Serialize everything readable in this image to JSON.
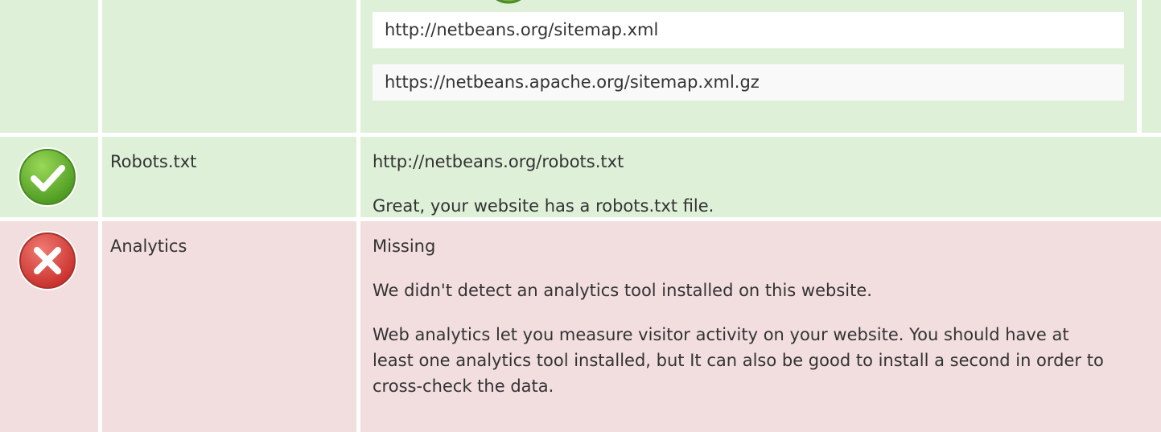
{
  "colors": {
    "pass_background": "#dff0d8",
    "fail_background": "#f2dede",
    "pass_icon": "#5cb85c",
    "fail_icon": "#d9534f"
  },
  "sitemap": {
    "icon": "check-icon",
    "urls": [
      "http://netbeans.org/sitemap.xml",
      "https://netbeans.apache.org/sitemap.xml.gz"
    ]
  },
  "robots": {
    "icon": "check-icon",
    "label": "Robots.txt",
    "url": "http://netbeans.org/robots.txt",
    "message": "Great, your website has a robots.txt file."
  },
  "analytics": {
    "icon": "error-x-icon",
    "label": "Analytics",
    "status": "Missing",
    "message": "We didn't detect an analytics tool installed on this website.",
    "advice": "Web analytics let you measure visitor activity on your website. You should have at least one analytics tool installed, but It can also be good to install a second in order to cross-check the data."
  }
}
